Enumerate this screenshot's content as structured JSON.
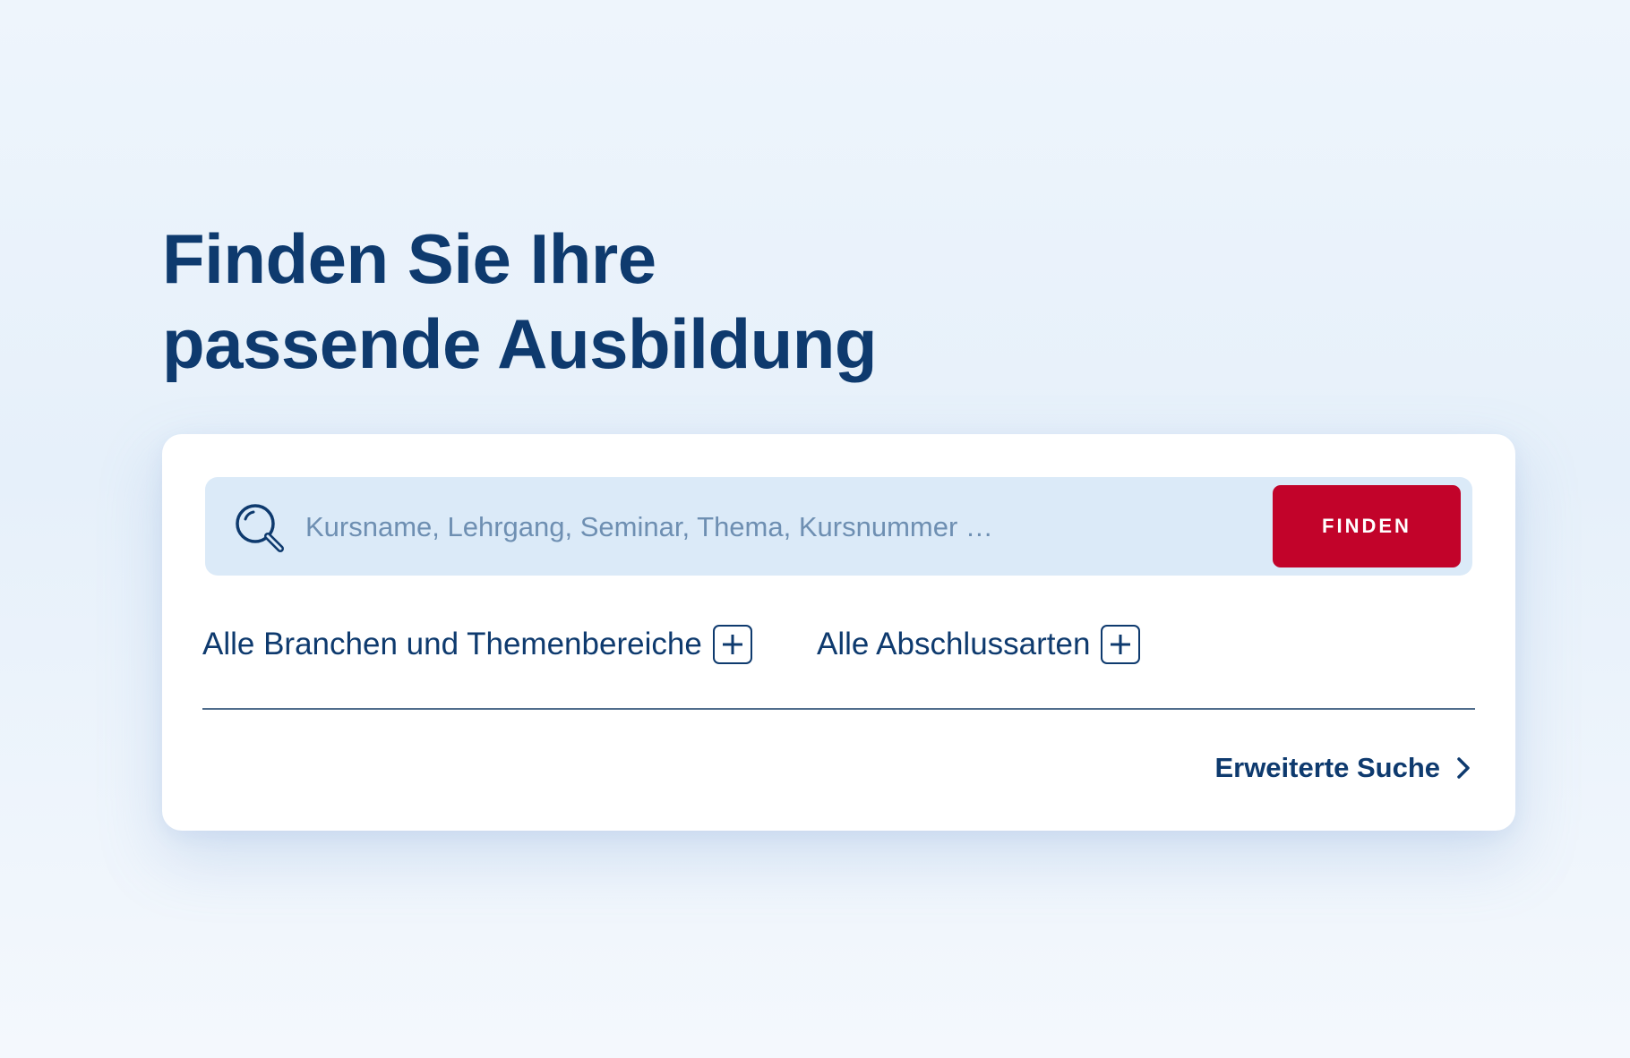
{
  "headline": {
    "line1": "Finden Sie Ihre",
    "line2": "passende Ausbildung"
  },
  "search": {
    "placeholder": "Kursname, Lehrgang, Seminar, Thema, Kursnummer …",
    "value": "",
    "icon": "search-icon",
    "button_label": "FINDEN"
  },
  "filters": [
    {
      "label": "Alle Branchen und Themenbereiche",
      "icon": "plus-icon"
    },
    {
      "label": "Alle Abschlussarten",
      "icon": "plus-icon"
    }
  ],
  "advanced_search": {
    "label": "Erweiterte Suche",
    "icon": "chevron-right-icon"
  },
  "colors": {
    "primary_text": "#0e3a6e",
    "accent_button": "#c2032a",
    "search_background": "#dbeaf8",
    "card_background": "#ffffff"
  }
}
